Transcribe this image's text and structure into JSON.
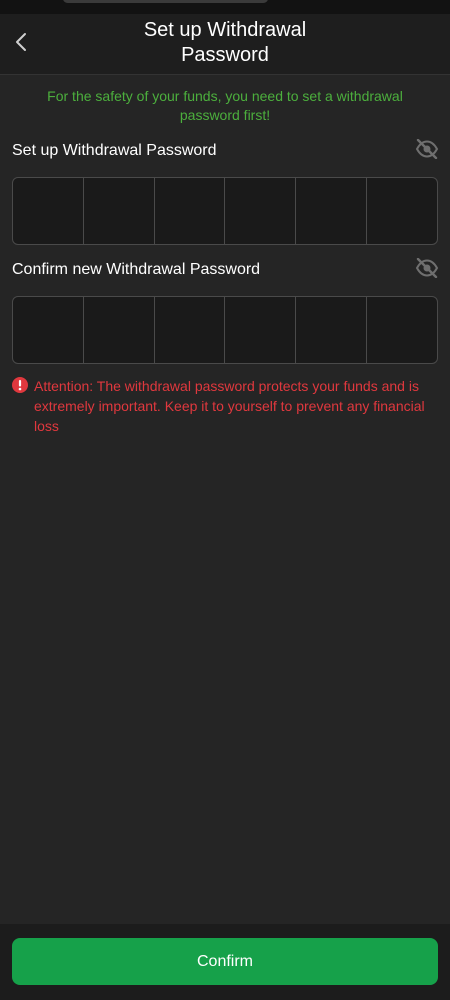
{
  "header": {
    "title_line1": "Set up Withdrawal",
    "title_line2": "Password",
    "back_icon": "chevron-left-icon"
  },
  "notice": {
    "text": "For the safety of your funds, you need to set a withdrawal password first!",
    "color": "#4caf3d"
  },
  "fields": {
    "password": {
      "label": "Set up Withdrawal Password",
      "visibility_icon": "eye-slash-icon",
      "digits": [
        "",
        "",
        "",
        "",
        "",
        ""
      ]
    },
    "confirm": {
      "label": "Confirm new Withdrawal Password",
      "visibility_icon": "eye-slash-icon",
      "digits": [
        "",
        "",
        "",
        "",
        "",
        ""
      ]
    }
  },
  "attention": {
    "icon": "exclamation-circle-icon",
    "text": "Attention: The withdrawal password protects your funds and is extremely important. Keep it to yourself to prevent any financial loss",
    "color": "#e0383e"
  },
  "footer": {
    "confirm_label": "Confirm",
    "confirm_color": "#16a14a"
  }
}
